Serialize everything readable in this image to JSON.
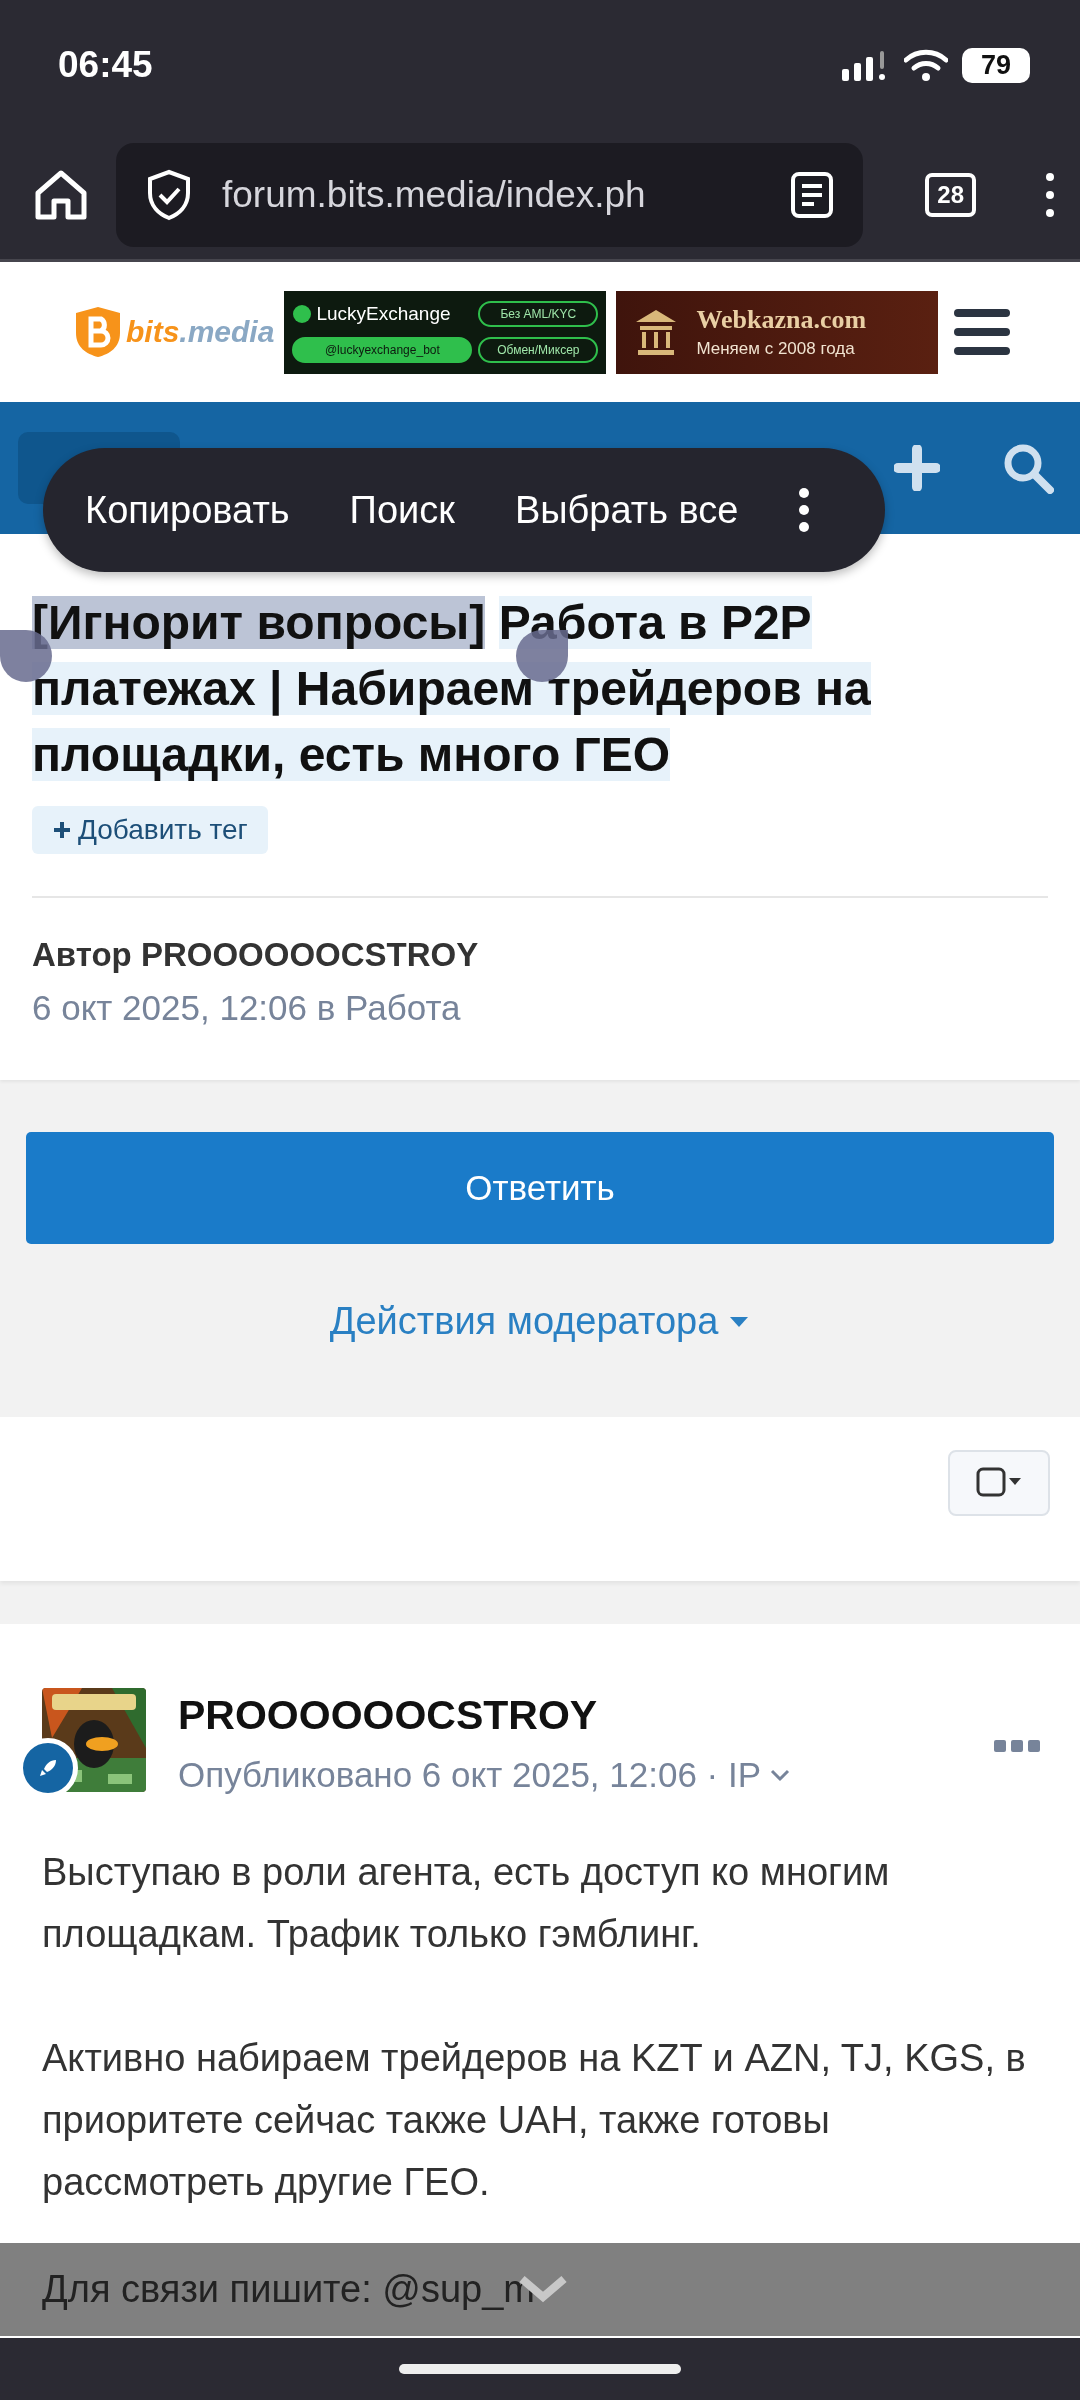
{
  "status_bar": {
    "time": "06:45",
    "battery": "79"
  },
  "browser": {
    "url": "forum.bits.media/index.ph",
    "tab_count": "28"
  },
  "site_header": {
    "logo": {
      "brand": "bits",
      "suffix": ".media"
    },
    "ads": [
      {
        "kind": "lucky",
        "title": "LuckyExchange",
        "tags": [
          "Без AML/KYC",
          "@luckyexchange_bot",
          "Обмен/Миксер"
        ]
      },
      {
        "kind": "kazna",
        "title": "Webkazna.com",
        "subtitle": "Меняем с 2008 года"
      }
    ]
  },
  "context_menu": {
    "items": [
      "Копировать",
      "Поиск",
      "Выбрать все"
    ]
  },
  "topic": {
    "selected_text": "[Игнорит вопросы]",
    "title_rest": "Работа в P2P платежах | Набираем трейдеров на площадки, есть много ГЕО",
    "tag_button": "Добавить тег",
    "author": "Автор PROOOOOOCSTROY",
    "meta": "6 окт 2025, 12:06 в Работа"
  },
  "reply_button": "Ответить",
  "moderator_actions": "Действия модератора",
  "post": {
    "author": "PROOOOOOCSTROY",
    "meta": "Опубликовано 6 окт 2025, 12:06 · IP",
    "paragraphs": [
      "Выступаю в роли агента, есть доступ ко многим площадкам. Трафик только гэмблинг.",
      "Активно набираем трейдеров на KZT и AZN, TJ, KGS, в приоритете сейчас также UAH, также готовы рассмотреть другие ГЕО."
    ],
    "contact": "Для связи пишите: @sup_m"
  }
}
